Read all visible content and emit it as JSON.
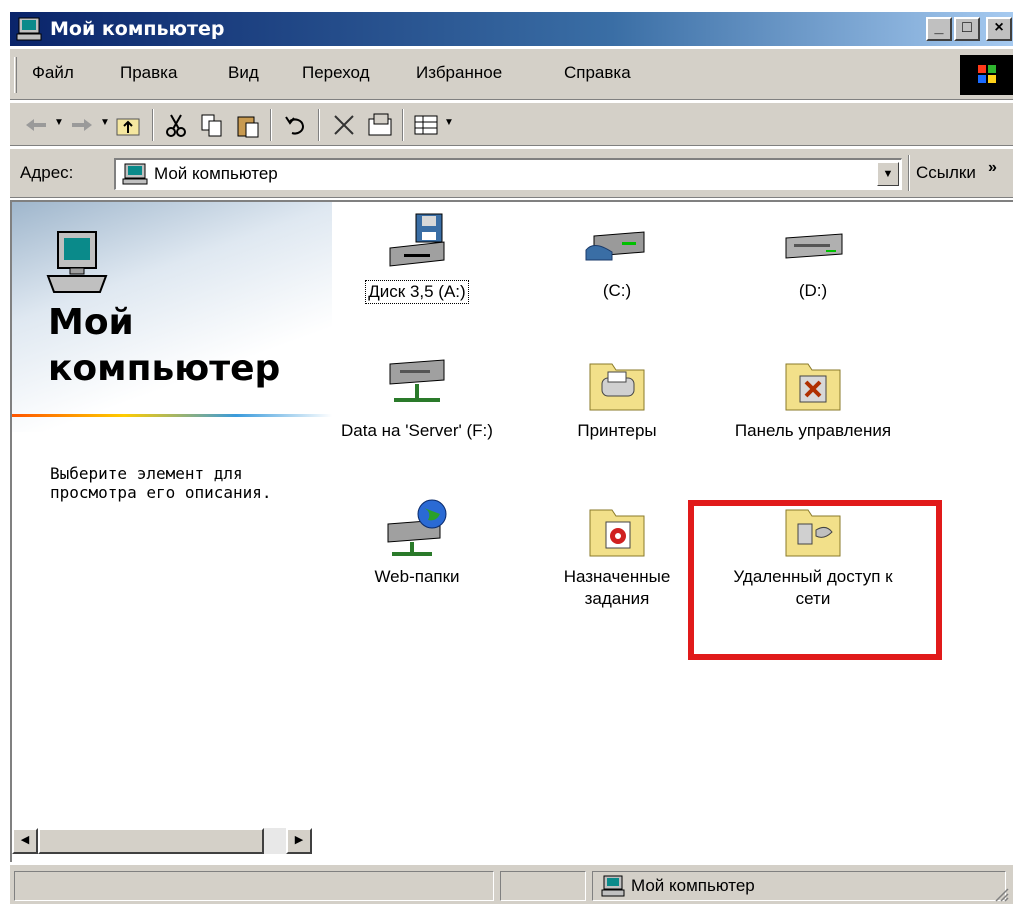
{
  "window": {
    "title": "Мой компьютер",
    "controls": {
      "minimize": "_",
      "maximize": "□",
      "close": "×"
    }
  },
  "menu": [
    {
      "label": "Файл"
    },
    {
      "label": "Правка"
    },
    {
      "label": "Вид"
    },
    {
      "label": "Переход"
    },
    {
      "label": "Избранное"
    },
    {
      "label": "Справка"
    }
  ],
  "toolbar": {
    "buttons": [
      "back-icon",
      "forward-icon",
      "up-folder-icon",
      "cut-icon",
      "copy-icon",
      "paste-icon",
      "undo-icon",
      "delete-icon",
      "properties-icon",
      "views-icon"
    ]
  },
  "address": {
    "label": "Адрес:",
    "value": "Мой компьютер",
    "links_label": "Ссылки",
    "links_chevron": "»"
  },
  "panel": {
    "title_line1": "Мой",
    "title_line2": "компьютер",
    "description": "Выберите элемент для просмотра его описания."
  },
  "items": [
    {
      "label": "Диск 3,5 (A:)",
      "icon": "floppy-drive-icon"
    },
    {
      "label": "(C:)",
      "icon": "hard-drive-icon"
    },
    {
      "label": "(D:)",
      "icon": "hard-drive-icon"
    },
    {
      "label": "Data на 'Server' (F:)",
      "icon": "network-drive-icon"
    },
    {
      "label": "Принтеры",
      "icon": "printers-folder-icon"
    },
    {
      "label": "Панель управления",
      "icon": "control-panel-folder-icon"
    },
    {
      "label": "Web-папки",
      "icon": "web-folders-icon"
    },
    {
      "label": "Назначенные задания",
      "icon": "scheduled-tasks-folder-icon"
    },
    {
      "label": "Удаленный доступ к сети",
      "icon": "dial-up-networking-folder-icon"
    }
  ],
  "status": {
    "zone": "Мой компьютер"
  },
  "colors": {
    "title_bar_start": "#0a246a",
    "title_bar_end": "#a6caf0",
    "face": "#d4d0c8",
    "highlight_box": "#e11a1a"
  }
}
